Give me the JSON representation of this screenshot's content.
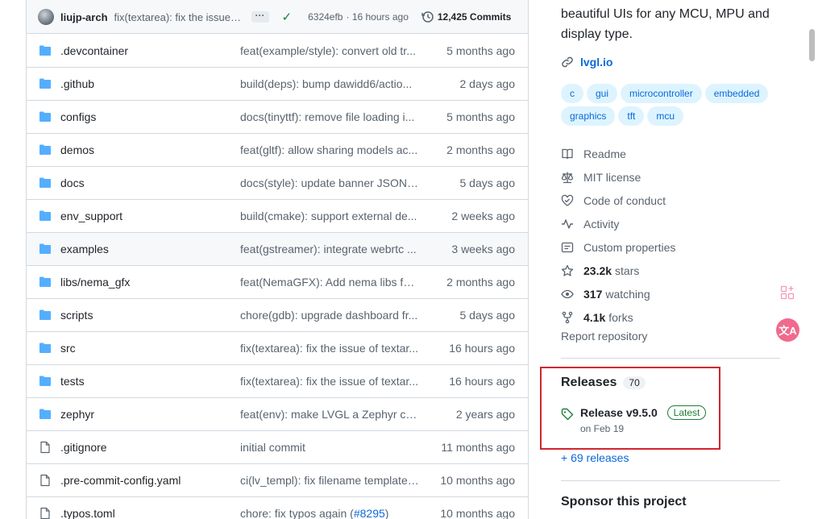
{
  "commit": {
    "author": "liujp-arch",
    "message": "fix(textarea): fix the issue of textarea...",
    "hash": "6324efb",
    "time": "· 16 hours ago",
    "count": "12,425 Commits"
  },
  "files": [
    {
      "type": "dir",
      "name": ".devcontainer",
      "message": "feat(example/style): convert old tr...",
      "time": "5 months ago"
    },
    {
      "type": "dir",
      "name": ".github",
      "message": "build(deps): bump dawidd6/actio...",
      "time": "2 days ago"
    },
    {
      "type": "dir",
      "name": "configs",
      "message": "docs(tinyttf): remove file loading i...",
      "time": "5 months ago"
    },
    {
      "type": "dir",
      "name": "demos",
      "message": "feat(gltf): allow sharing models ac...",
      "time": "2 months ago"
    },
    {
      "type": "dir",
      "name": "docs",
      "message": "docs(style): update banner JSON ...",
      "time": "5 days ago"
    },
    {
      "type": "dir",
      "name": "env_support",
      "message": "build(cmake): support external de...",
      "time": "2 weeks ago"
    },
    {
      "type": "dir",
      "name": "examples",
      "message": "feat(gstreamer): integrate webrtc ...",
      "time": "3 weeks ago"
    },
    {
      "type": "dir",
      "name": "libs/nema_gfx",
      "message": "feat(NemaGFX): Add nema libs for...",
      "time": "2 months ago"
    },
    {
      "type": "dir",
      "name": "scripts",
      "message": "chore(gdb): upgrade dashboard fr...",
      "time": "5 days ago"
    },
    {
      "type": "dir",
      "name": "src",
      "message": "fix(textarea): fix the issue of textar...",
      "time": "16 hours ago"
    },
    {
      "type": "dir",
      "name": "tests",
      "message": "fix(textarea): fix the issue of textar...",
      "time": "16 hours ago"
    },
    {
      "type": "dir",
      "name": "zephyr",
      "message": "feat(env): make LVGL a Zephyr co...",
      "time": "2 years ago"
    },
    {
      "type": "file",
      "name": ".gitignore",
      "message": "initial commit",
      "time": "11 months ago"
    },
    {
      "type": "file",
      "name": ".pre-commit-config.yaml",
      "message": "ci(lv_templ): fix filename template ...",
      "time": "10 months ago"
    },
    {
      "type": "file",
      "name": ".typos.toml",
      "message": "chore: fix typos again (",
      "link": "#8295",
      "message_end": ")",
      "time": "10 months ago"
    }
  ],
  "about": {
    "description": "beautiful UIs for any MCU, MPU and display type.",
    "website": "lvgl.io",
    "topics": [
      "c",
      "gui",
      "microcontroller",
      "embedded",
      "graphics",
      "tft",
      "mcu"
    ]
  },
  "meta": {
    "readme": "Readme",
    "license": "MIT license",
    "conduct": "Code of conduct",
    "activity": "Activity",
    "properties": "Custom properties",
    "stars_value": "23.2k",
    "stars_label": "stars",
    "watching_value": "317",
    "watching_label": "watching",
    "forks_value": "4.1k",
    "forks_label": "forks",
    "report": "Report repository"
  },
  "releases": {
    "title": "Releases",
    "count": "70",
    "latest_name": "Release v9.5.0",
    "latest_badge": "Latest",
    "latest_date": "on Feb 19",
    "more": "+ 69 releases"
  },
  "sponsor": {
    "title": "Sponsor this project"
  },
  "colors": {
    "accent": "#0969da",
    "highlight_border": "#d1242f",
    "latest_green": "#1a7f37"
  }
}
